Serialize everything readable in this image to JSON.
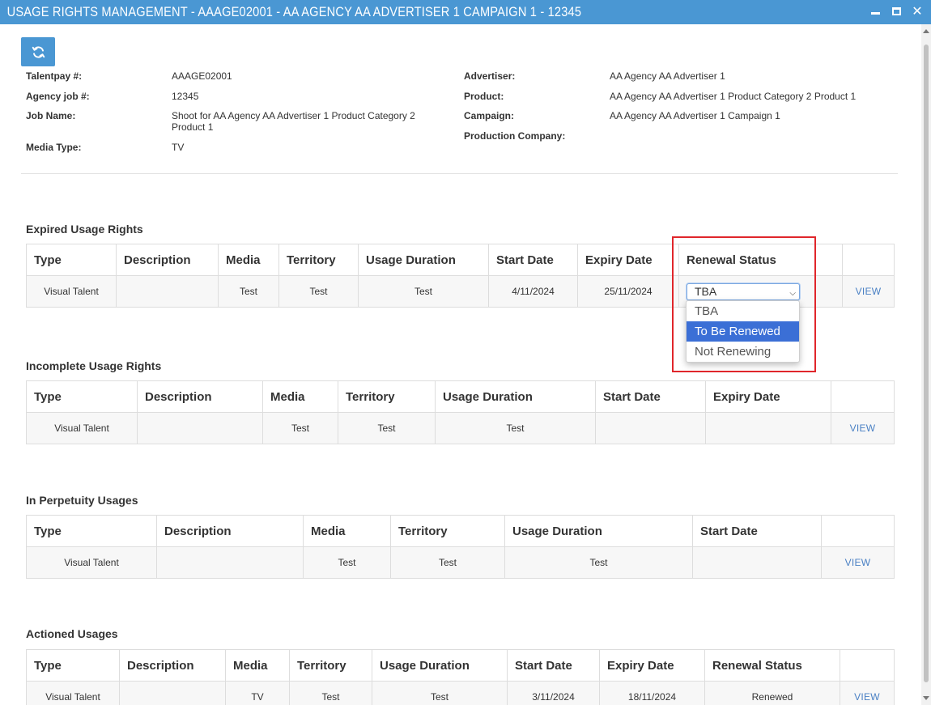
{
  "window": {
    "title": "USAGE RIGHTS MANAGEMENT - AAAGE02001 - AA AGENCY AA ADVERTISER 1 CAMPAIGN 1 - 12345"
  },
  "toolbar": {
    "refresh_icon": "refresh-icon"
  },
  "details_left": [
    {
      "label": "Talentpay #:",
      "value": "AAAGE02001"
    },
    {
      "label": "Agency job #:",
      "value": "12345"
    },
    {
      "label": "Job Name:",
      "value": "Shoot for AA Agency AA Advertiser 1 Product Category 2",
      "value2": "Product 1"
    },
    {
      "label": "Media Type:",
      "value": "TV"
    }
  ],
  "details_right": [
    {
      "label": "Advertiser:",
      "value": "AA Agency AA Advertiser 1"
    },
    {
      "label": "Product:",
      "value": "AA Agency AA Advertiser 1 Product Category 2 Product 1"
    },
    {
      "label": "Campaign:",
      "value": "AA Agency AA Advertiser 1 Campaign 1"
    },
    {
      "label": "Production Company:",
      "value": ""
    }
  ],
  "expired": {
    "title": "Expired Usage Rights",
    "headers": [
      "Type",
      "Description",
      "Media",
      "Territory",
      "Usage Duration",
      "Start Date",
      "Expiry Date",
      "Renewal Status",
      ""
    ],
    "row": {
      "type": "Visual Talent",
      "description": "",
      "media": "Test",
      "territory": "Test",
      "usage_duration": "Test",
      "start_date": "4/11/2024",
      "expiry_date": "25/11/2024",
      "renewal_status": "TBA",
      "action": "VIEW"
    },
    "renewal_options": [
      "TBA",
      "To Be Renewed",
      "Not Renewing"
    ],
    "highlighted_option": "To Be Renewed"
  },
  "incomplete": {
    "title": "Incomplete Usage Rights",
    "headers": [
      "Type",
      "Description",
      "Media",
      "Territory",
      "Usage Duration",
      "Start Date",
      "Expiry Date",
      ""
    ],
    "row": {
      "type": "Visual Talent",
      "description": "",
      "media": "Test",
      "territory": "Test",
      "usage_duration": "Test",
      "start_date": "",
      "expiry_date": "",
      "action": "VIEW"
    }
  },
  "perpetuity": {
    "title": "In Perpetuity Usages",
    "headers": [
      "Type",
      "Description",
      "Media",
      "Territory",
      "Usage Duration",
      "Start Date",
      ""
    ],
    "row": {
      "type": "Visual Talent",
      "description": "",
      "media": "Test",
      "territory": "Test",
      "usage_duration": "Test",
      "start_date": "",
      "action": "VIEW"
    }
  },
  "actioned": {
    "title": "Actioned Usages",
    "headers": [
      "Type",
      "Description",
      "Media",
      "Territory",
      "Usage Duration",
      "Start Date",
      "Expiry Date",
      "Renewal Status",
      ""
    ],
    "row": {
      "type": "Visual Talent",
      "description": "",
      "media": "TV",
      "territory": "Test",
      "usage_duration": "Test",
      "start_date": "3/11/2024",
      "expiry_date": "18/11/2024",
      "renewal_status": "Renewed",
      "action": "VIEW"
    }
  },
  "colors": {
    "titlebar": "#4a97d3",
    "link": "#4a80c4",
    "selected_option": "#3b6fd6",
    "highlight_border": "#e0262b"
  }
}
